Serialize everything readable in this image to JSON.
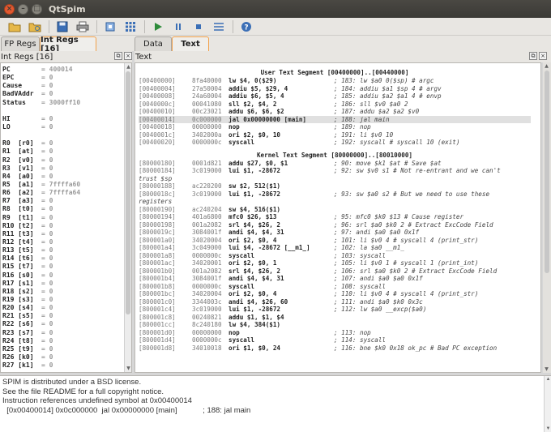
{
  "window": {
    "title": "QtSpim"
  },
  "toolbar": {
    "buttons": [
      {
        "icon": "open-folder-icon"
      },
      {
        "icon": "reload-folder-icon"
      },
      {
        "icon": "save-icon"
      },
      {
        "icon": "print-icon"
      },
      {
        "icon": "clear-registers-icon"
      },
      {
        "icon": "reinitialize-icon"
      },
      {
        "icon": "run-icon"
      },
      {
        "icon": "pause-icon"
      },
      {
        "icon": "stop-icon"
      },
      {
        "icon": "single-step-icon"
      },
      {
        "icon": "help-icon"
      }
    ]
  },
  "reg_tabs": [
    {
      "label": "FP Regs",
      "active": false
    },
    {
      "label": "Int Regs [16]",
      "active": true
    }
  ],
  "text_tabs": [
    {
      "label": "Data",
      "active": false
    },
    {
      "label": "Text",
      "active": true
    }
  ],
  "reg_pane": {
    "title": "Int Regs [16]",
    "special": [
      {
        "name": "PC",
        "value": "= 400014"
      },
      {
        "name": "EPC",
        "value": "= 0"
      },
      {
        "name": "Cause",
        "value": "= 0"
      },
      {
        "name": "BadVAddr",
        "value": "= 0"
      },
      {
        "name": "Status",
        "value": "= 3000ff10"
      },
      {
        "name": "",
        "value": ""
      },
      {
        "name": "HI",
        "value": "= 0"
      },
      {
        "name": "LO",
        "value": "= 0"
      },
      {
        "name": "",
        "value": ""
      }
    ],
    "regs": [
      {
        "name": "R0  [r0]",
        "value": "= 0"
      },
      {
        "name": "R1  [at]",
        "value": "= 0"
      },
      {
        "name": "R2  [v0]",
        "value": "= 0"
      },
      {
        "name": "R3  [v1]",
        "value": "= 0"
      },
      {
        "name": "R4  [a0]",
        "value": "= 0"
      },
      {
        "name": "R5  [a1]",
        "value": "= 7ffffa60"
      },
      {
        "name": "R6  [a2]",
        "value": "= 7ffffa64"
      },
      {
        "name": "R7  [a3]",
        "value": "= 0"
      },
      {
        "name": "R8  [t0]",
        "value": "= 0"
      },
      {
        "name": "R9  [t1]",
        "value": "= 0"
      },
      {
        "name": "R10 [t2]",
        "value": "= 0"
      },
      {
        "name": "R11 [t3]",
        "value": "= 0"
      },
      {
        "name": "R12 [t4]",
        "value": "= 0"
      },
      {
        "name": "R13 [t5]",
        "value": "= 0"
      },
      {
        "name": "R14 [t6]",
        "value": "= 0"
      },
      {
        "name": "R15 [t7]",
        "value": "= 0"
      },
      {
        "name": "R16 [s0]",
        "value": "= 0"
      },
      {
        "name": "R17 [s1]",
        "value": "= 0"
      },
      {
        "name": "R18 [s2]",
        "value": "= 0"
      },
      {
        "name": "R19 [s3]",
        "value": "= 0"
      },
      {
        "name": "R20 [s4]",
        "value": "= 0"
      },
      {
        "name": "R21 [s5]",
        "value": "= 0"
      },
      {
        "name": "R22 [s6]",
        "value": "= 0"
      },
      {
        "name": "R23 [s7]",
        "value": "= 0"
      },
      {
        "name": "R24 [t8]",
        "value": "= 0"
      },
      {
        "name": "R25 [t9]",
        "value": "= 0"
      },
      {
        "name": "R26 [k0]",
        "value": "= 0"
      },
      {
        "name": "R27 [k1]",
        "value": "= 0"
      }
    ]
  },
  "text_pane": {
    "title": "Text",
    "user_segment": "User Text Segment [00400000]..[00440000]",
    "user_lines": [
      {
        "addr": "[00400000]",
        "code": "8fa40000",
        "instr": "lw $4, 0($29)",
        "comment": "; 183: lw $a0 0($sp) # argc"
      },
      {
        "addr": "[00400004]",
        "code": "27a50004",
        "instr": "addiu $5, $29, 4",
        "comment": "; 184: addiu $a1 $sp 4 # argv"
      },
      {
        "addr": "[00400008]",
        "code": "24a60004",
        "instr": "addiu $6, $5, 4",
        "comment": "; 185: addiu $a2 $a1 4 # envp"
      },
      {
        "addr": "[0040000c]",
        "code": "00041080",
        "instr": "sll $2, $4, 2",
        "comment": "; 186: sll $v0 $a0 2"
      },
      {
        "addr": "[00400010]",
        "code": "00c23021",
        "instr": "addu $6, $6, $2",
        "comment": "; 187: addu $a2 $a2 $v0"
      },
      {
        "addr": "[00400014]",
        "code": "0c000000",
        "instr": "jal 0x00000000 [main]",
        "comment": "; 188: jal main",
        "highlight": true
      },
      {
        "addr": "[00400018]",
        "code": "00000000",
        "instr": "nop",
        "comment": "; 189: nop"
      },
      {
        "addr": "[0040001c]",
        "code": "3402000a",
        "instr": "ori $2, $0, 10",
        "comment": "; 191: li $v0 10"
      },
      {
        "addr": "[00400020]",
        "code": "0000000c",
        "instr": "syscall",
        "comment": "; 192: syscall # syscall 10 (exit)"
      }
    ],
    "kernel_segment": "Kernel Text Segment [80000000]..[80010000]",
    "kernel_lines": [
      {
        "addr": "[80000180]",
        "code": "0001d821",
        "instr": "addu $27, $0, $1",
        "comment": "; 90: move $k1 $at # Save $at"
      },
      {
        "addr": "[80000184]",
        "code": "3c019000",
        "instr": "lui $1, -28672",
        "comment": "; 92: sw $v0 s1 # Not re-entrant and we can't",
        "cont": "trust $sp"
      },
      {
        "addr": "[80000188]",
        "code": "ac220200",
        "instr": "sw $2, 512($1)",
        "comment": ""
      },
      {
        "addr": "[8000018c]",
        "code": "3c019000",
        "instr": "lui $1, -28672",
        "comment": "; 93: sw $a0 s2 # But we need to use these",
        "cont": "registers"
      },
      {
        "addr": "[80000190]",
        "code": "ac240204",
        "instr": "sw $4, 516($1)",
        "comment": ""
      },
      {
        "addr": "[80000194]",
        "code": "401a6800",
        "instr": "mfc0 $26, $13",
        "comment": "; 95: mfc0 $k0 $13 # Cause register"
      },
      {
        "addr": "[80000198]",
        "code": "001a2082",
        "instr": "srl $4, $26, 2",
        "comment": "; 96: srl $a0 $k0 2 # Extract ExcCode Field"
      },
      {
        "addr": "[8000019c]",
        "code": "3084001f",
        "instr": "andi $4, $4, 31",
        "comment": "; 97: andi $a0 $a0 0x1f"
      },
      {
        "addr": "[800001a0]",
        "code": "34020004",
        "instr": "ori $2, $0, 4",
        "comment": "; 101: li $v0 4 # syscall 4 (print_str)"
      },
      {
        "addr": "[800001a4]",
        "code": "3c049000",
        "instr": "lui $4, -28672 [__m1_]",
        "comment": "; 102: la $a0 __m1_"
      },
      {
        "addr": "[800001a8]",
        "code": "0000000c",
        "instr": "syscall",
        "comment": "; 103: syscall"
      },
      {
        "addr": "[800001ac]",
        "code": "34020001",
        "instr": "ori $2, $0, 1",
        "comment": "; 105: li $v0 1 # syscall 1 (print_int)"
      },
      {
        "addr": "[800001b0]",
        "code": "001a2082",
        "instr": "srl $4, $26, 2",
        "comment": "; 106: srl $a0 $k0 2 # Extract ExcCode Field"
      },
      {
        "addr": "[800001b4]",
        "code": "3084001f",
        "instr": "andi $4, $4, 31",
        "comment": "; 107: andi $a0 $a0 0x1f"
      },
      {
        "addr": "[800001b8]",
        "code": "0000000c",
        "instr": "syscall",
        "comment": "; 108: syscall"
      },
      {
        "addr": "[800001bc]",
        "code": "34020004",
        "instr": "ori $2, $0, 4",
        "comment": "; 110: li $v0 4 # syscall 4 (print_str)"
      },
      {
        "addr": "[800001c0]",
        "code": "3344003c",
        "instr": "andi $4, $26, 60",
        "comment": "; 111: andi $a0 $k0 0x3c"
      },
      {
        "addr": "[800001c4]",
        "code": "3c019000",
        "instr": "lui $1, -28672",
        "comment": "; 112: lw $a0 __excp($a0)"
      },
      {
        "addr": "[800001c8]",
        "code": "00240821",
        "instr": "addu $1, $1, $4",
        "comment": ""
      },
      {
        "addr": "[800001cc]",
        "code": "8c240180",
        "instr": "lw $4, 384($1)",
        "comment": ""
      },
      {
        "addr": "[800001d0]",
        "code": "00000000",
        "instr": "nop",
        "comment": "; 113: nop"
      },
      {
        "addr": "[800001d4]",
        "code": "0000000c",
        "instr": "syscall",
        "comment": "; 114: syscall"
      },
      {
        "addr": "[800001d8]",
        "code": "34010018",
        "instr": "ori $1, $0, 24",
        "comment": "; 116: bne $k0 0x18 ok_pc # Bad PC exception"
      }
    ]
  },
  "console": {
    "lines": [
      "SPIM is distributed under a BSD license.",
      "See the file README for a full copyright notice.",
      "Instruction references undefined symbol at 0x00400014",
      "  [0x00400014] 0x0c000000  jal 0x00000000 [main]            ; 188: jal main"
    ]
  }
}
